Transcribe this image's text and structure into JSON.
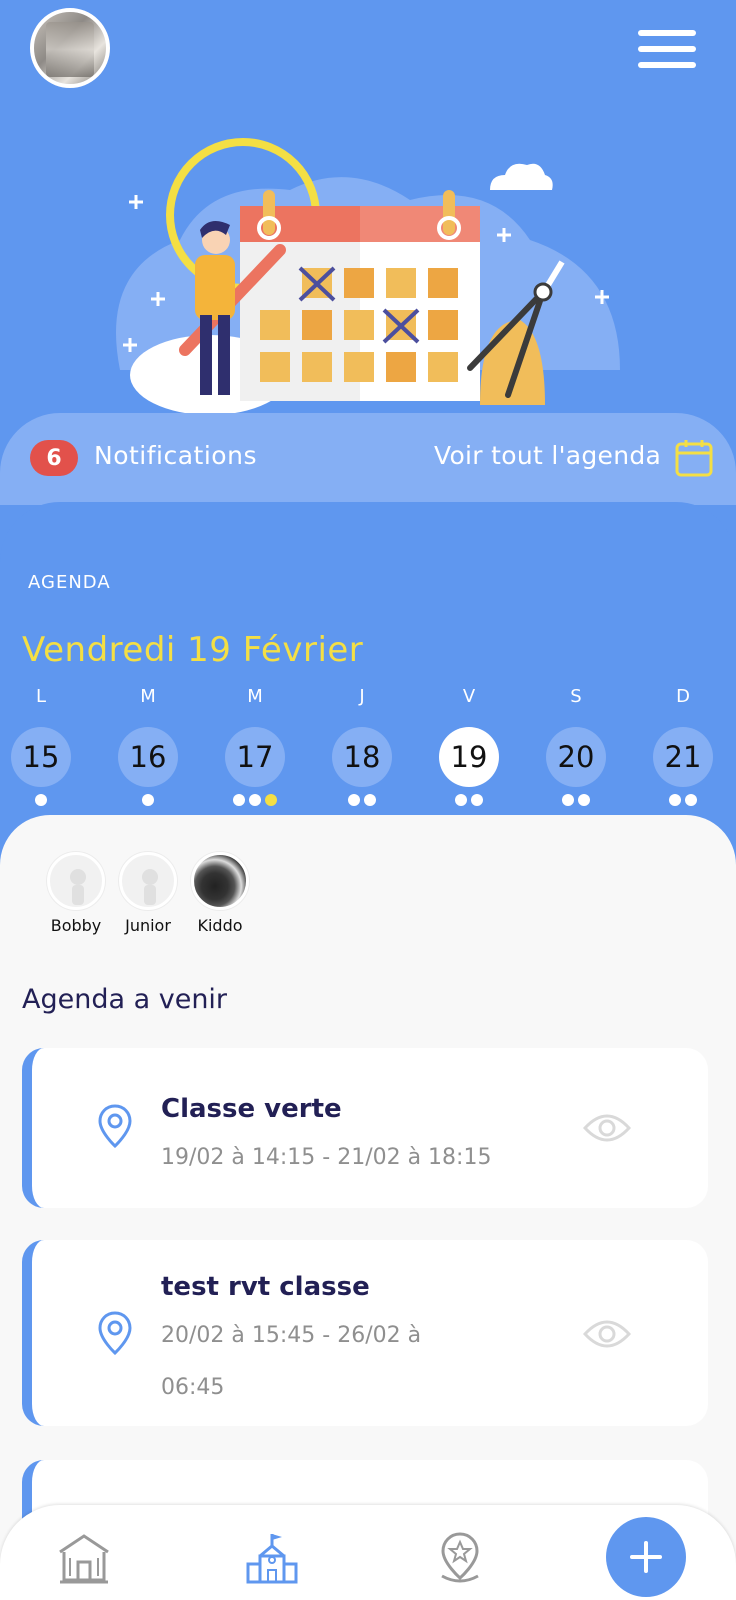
{
  "header": {
    "avatar_icon": "user-avatar",
    "menu_icon": "hamburger-menu-icon"
  },
  "notifications": {
    "count": "6",
    "label": "Notifications",
    "see_all": "Voir tout l'agenda",
    "calendar_icon": "calendar-icon"
  },
  "agenda": {
    "section_label": "AGENDA",
    "date_title": "Vendredi 19 Février",
    "days": [
      {
        "letter": "L",
        "num": "15",
        "dots": [
          "w"
        ]
      },
      {
        "letter": "M",
        "num": "16",
        "dots": [
          "w"
        ]
      },
      {
        "letter": "M",
        "num": "17",
        "dots": [
          "w",
          "w",
          "y"
        ]
      },
      {
        "letter": "J",
        "num": "18",
        "dots": [
          "w",
          "w"
        ]
      },
      {
        "letter": "V",
        "num": "19",
        "dots": [
          "w",
          "w"
        ],
        "selected": true
      },
      {
        "letter": "S",
        "num": "20",
        "dots": [
          "w",
          "w"
        ]
      },
      {
        "letter": "D",
        "num": "21",
        "dots": [
          "w",
          "w"
        ]
      }
    ]
  },
  "children": [
    {
      "name": "Bobby"
    },
    {
      "name": "Junior"
    },
    {
      "name": "Kiddo"
    }
  ],
  "upcoming": {
    "title": "Agenda a venir",
    "events": [
      {
        "title": "Classe verte",
        "time": "19/02 à 14:15 - 21/02 à 18:15"
      },
      {
        "title": "test rvt classe",
        "time": "20/02 à 15:45 - 26/02 à 06:45"
      }
    ]
  },
  "bottom_nav": {
    "items": [
      "home-icon",
      "school-icon",
      "location-star-icon",
      "add-icon"
    ]
  },
  "colors": {
    "primary": "#5f97ef",
    "light_blue": "#85aff4",
    "accent_yellow": "#f4df44",
    "badge_red": "#e2514b",
    "title_navy": "#222055"
  }
}
